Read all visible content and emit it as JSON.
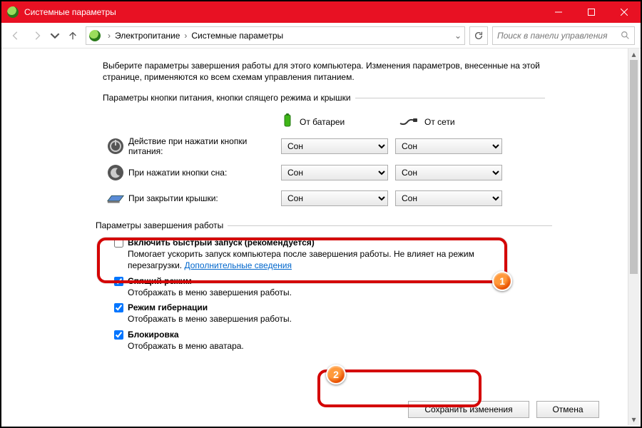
{
  "window": {
    "title": "Системные параметры"
  },
  "breadcrumb": {
    "level1": "Электропитание",
    "level2": "Системные параметры"
  },
  "search": {
    "placeholder": "Поиск в панели управления"
  },
  "intro": "Выберите параметры завершения работы для этого компьютера. Изменения параметров, внесенные на этой странице, применяются ко всем схемам управления питанием.",
  "section_buttons": {
    "legend": "Параметры кнопки питания, кнопки спящего режима и крышки",
    "col_battery": "От батареи",
    "col_ac": "От сети",
    "rows": [
      {
        "label": "Действие при нажатии кнопки питания:",
        "battery": "Сон",
        "ac": "Сон"
      },
      {
        "label": "При нажатии кнопки сна:",
        "battery": "Сон",
        "ac": "Сон"
      },
      {
        "label": "При закрытии крышки:",
        "battery": "Сон",
        "ac": "Сон"
      }
    ]
  },
  "section_shutdown": {
    "legend": "Параметры завершения работы",
    "options": [
      {
        "checked": false,
        "title": "Включить быстрый запуск (рекомендуется)",
        "desc_before": "Помогает ускорить запуск компьютера после завершения работы. Не влияет на режим перезагрузки. ",
        "link": "Дополнительные сведения"
      },
      {
        "checked": true,
        "title": "Спящий режим",
        "desc": "Отображать в меню завершения работы."
      },
      {
        "checked": true,
        "title": "Режим гибернации",
        "desc": "Отображать в меню завершения работы."
      },
      {
        "checked": true,
        "title": "Блокировка",
        "desc": "Отображать в меню аватара."
      }
    ]
  },
  "buttons": {
    "save": "Сохранить изменения",
    "cancel": "Отмена"
  },
  "badges": {
    "one": "1",
    "two": "2"
  }
}
